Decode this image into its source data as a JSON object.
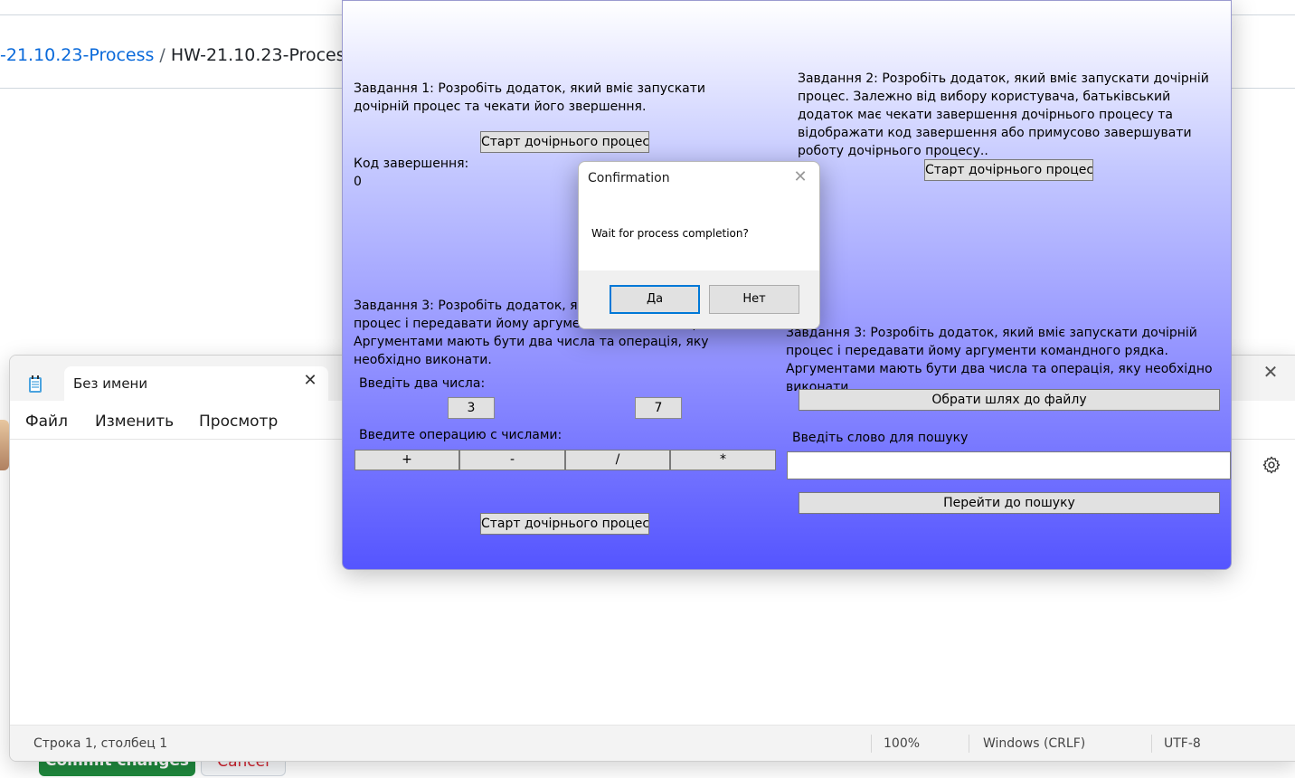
{
  "github": {
    "breadcrumb_parent": "-21.10.23-Process",
    "breadcrumb_separator": "/",
    "breadcrumb_current": "HW-21.10.23-Process",
    "commit_button": "Commit changes",
    "cancel_button": "Cancel"
  },
  "notepad": {
    "tab_title": "Без имени",
    "menu": [
      "Файл",
      "Изменить",
      "Просмотр"
    ],
    "status": {
      "position": "Строка 1, столбец 1",
      "zoom": "100%",
      "line_endings": "Windows (CRLF)",
      "encoding": "UTF-8"
    }
  },
  "app": {
    "task1": {
      "text": "Завдання 1: Розробіть додаток, який вміє запускати дочірній процес та чекати його звершення.",
      "start_button": "Старт дочірнього процесу",
      "exit_code_label": "Код завершення:",
      "exit_code_value": "0"
    },
    "task2": {
      "text": "Завдання 2: Розробіть додаток, який вміє запускати дочірній процес. Залежно від вибору користувача, батьківський додаток має чекати завершення дочірнього процесу та відображати код завершення або примусово завершувати роботу дочірнього процесу..",
      "start_button": "Старт дочірнього процесу"
    },
    "task3_left": {
      "text": "Завдання 3: Розробіть додаток, який вміє запускати дочірній процес і передавати йому аргументи командного рядка. Аргументами мають бути два числа та операція, яку необхідно виконати.",
      "numbers_label": "Введіть два числа:",
      "number1": "3",
      "number2": "7",
      "operation_label": "Введите операцию с числами:",
      "operations": [
        "+",
        "-",
        "/",
        "*"
      ],
      "start_button": "Старт дочірнього процесу"
    },
    "task3_right": {
      "text": "Завдання 3: Розробіть додаток, який вміє запускати дочірній процес і передавати йому аргументи командного рядка. Аргументами мають бути два числа та операція, яку необхідно виконати.",
      "choose_file_button": "Обрати шлях до файлу",
      "search_label": "Введіть слово для пошуку",
      "search_value": "",
      "search_button": "Перейти до пошуку"
    }
  },
  "dialog": {
    "title": "Confirmation",
    "message": "Wait for process completion?",
    "yes_button": "Да",
    "no_button": "Нет"
  },
  "colors": {
    "app_gradient_top": "#ffffff",
    "app_gradient_bottom": "#5555ff",
    "github_link": "#0969da",
    "commit_green": "#1f883d"
  }
}
